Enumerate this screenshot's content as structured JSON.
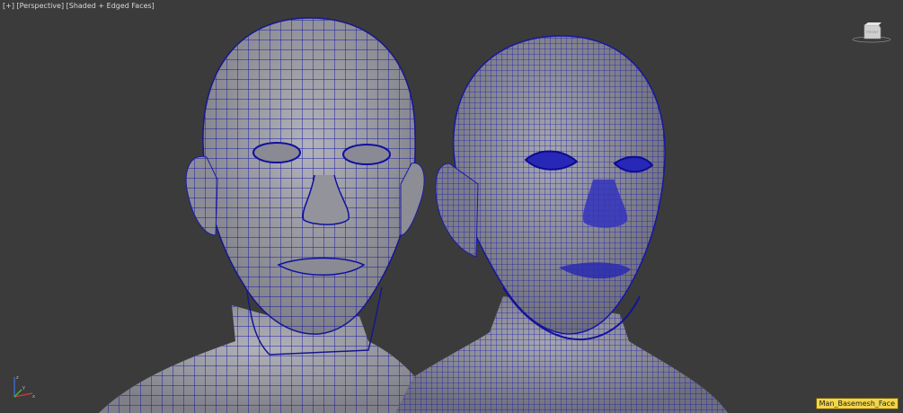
{
  "viewport": {
    "label_menu": "[+]",
    "label_view": "[Perspective]",
    "label_shading": "[Shaded + Edged Faces]"
  },
  "viewcube": {
    "face_label": "FRONT",
    "icon": "viewcube-icon"
  },
  "axis_gizmo": {
    "icon": "axis-tripod-icon",
    "x": "x",
    "y": "y",
    "z": "z"
  },
  "selection": {
    "object_name": "Man_Basemesh_Face"
  },
  "colors": {
    "background": "#3b3b3b",
    "mesh_shaded": "#9a9aa2",
    "wire": "#1a1aa8",
    "selection_tag": "#f2d54a"
  }
}
